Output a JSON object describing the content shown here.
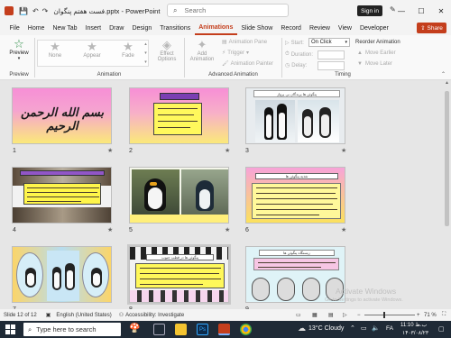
{
  "titlebar": {
    "title": "فست هفتم پنگوان.pptx - PowerPoint",
    "search_placeholder": "Search",
    "signin_label": "Sign in",
    "window": {
      "minimize": "—",
      "maximize": "☐",
      "close": "✕"
    }
  },
  "menubar": {
    "items": [
      "File",
      "Home",
      "New Tab",
      "Insert",
      "Draw",
      "Design",
      "Transitions",
      "Animations",
      "Slide Show",
      "Record",
      "Review",
      "View",
      "Developer"
    ],
    "active": "Animations",
    "share_label": "Share"
  },
  "ribbon": {
    "preview_label": "Preview",
    "preview_group": "Preview",
    "animation_items": [
      "None",
      "Appear",
      "Fade"
    ],
    "effect_options": "Effect Options",
    "animation_group": "Animation",
    "add_animation": "Add Animation",
    "animation_pane": "Animation Pane",
    "trigger": "Trigger",
    "animation_painter": "Animation Painter",
    "advanced_group": "Advanced Animation",
    "start_label": "Start:",
    "start_value": "On Click",
    "duration_label": "Duration:",
    "delay_label": "Delay:",
    "timing_group": "Timing",
    "reorder_label": "Reorder Animation",
    "move_earlier": "Move Earlier",
    "move_later": "Move Later"
  },
  "slides": {
    "numbers": [
      "1",
      "2",
      "3",
      "4",
      "5",
      "6",
      "7",
      "8",
      "9"
    ],
    "slide1_text": "بسم الله الرحمن الرحیم",
    "slide3_title": "پنگوئن ها پرندگان بی پرواز",
    "slide6_title": "تغذیه پنگوئن ها",
    "slide7_title": "",
    "slide8_title": "پنگوئن ها در قطب جنوب",
    "slide9_title": "زیستگاه پنگوئن ها"
  },
  "statusbar": {
    "slide_info": "Slide 12 of 12",
    "language": "English (United States)",
    "accessibility": "Accessibility: Investigate",
    "zoom": "71 %"
  },
  "watermark": {
    "line1": "Activate Windows",
    "line2": "Go to Settings to activate Windows."
  },
  "taskbar": {
    "search_placeholder": "Type here to search",
    "weather": "13°C  Cloudy",
    "lang": "FA",
    "time": "11:10 ب.ظ",
    "date": "۱۴۰۳/۰۸/۲۳"
  },
  "colors": {
    "accent": "#c43e1c",
    "taskbar": "#1f2a36"
  }
}
